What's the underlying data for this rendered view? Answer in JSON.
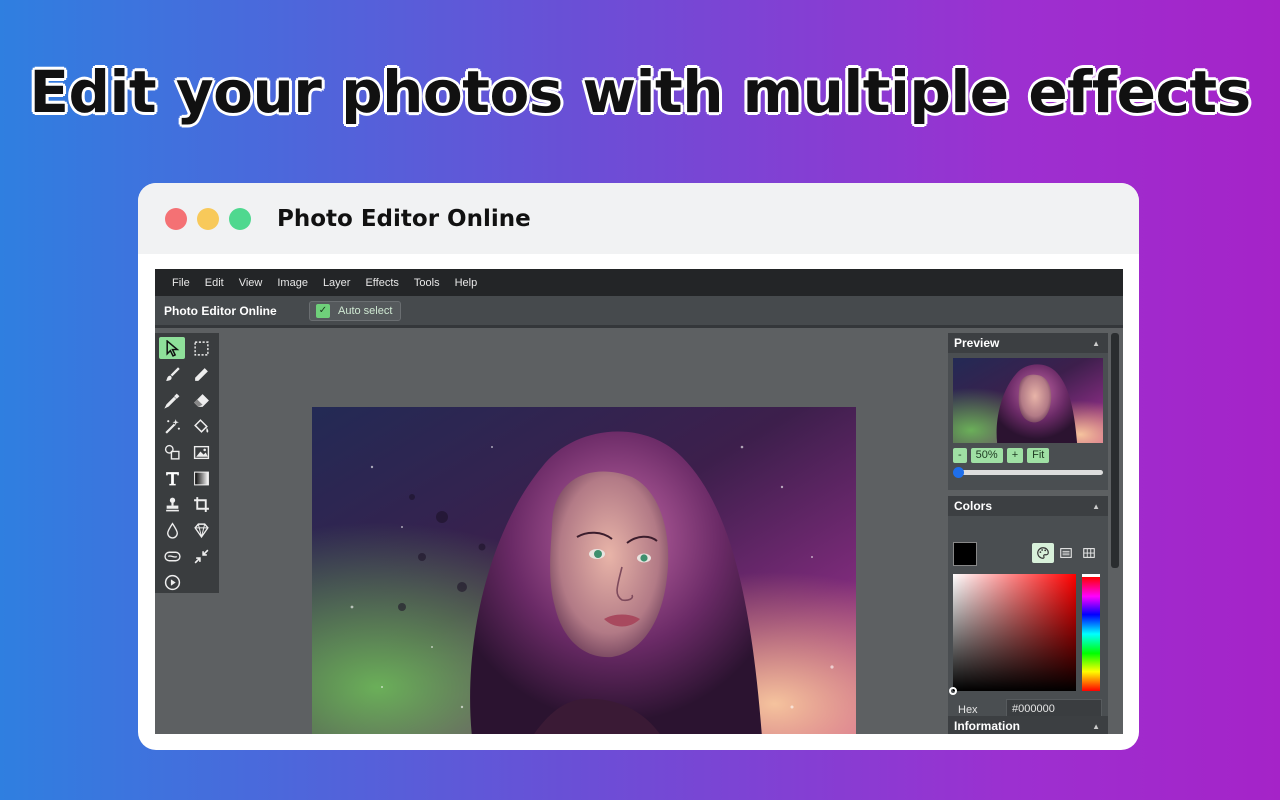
{
  "headline": "Edit your photos with multiple effects",
  "window": {
    "title": "Photo Editor Online"
  },
  "menu": [
    "File",
    "Edit",
    "View",
    "Image",
    "Layer",
    "Effects",
    "Tools",
    "Help"
  ],
  "toolbar": {
    "app_name": "Photo Editor Online",
    "auto_select_label": "Auto select",
    "auto_select_checked": true
  },
  "tools": [
    "select-tool",
    "marquee-select-tool",
    "brush-tool",
    "pencil-tool",
    "eyedropper-tool",
    "eraser-tool",
    "magic-wand-tool",
    "fill-tool",
    "shapes-tool",
    "image-tool",
    "text-tool",
    "gradient-tool",
    "clone-stamp-tool",
    "crop-tool",
    "blur-tool",
    "sharpen-tool",
    "bulge-tool",
    "shrink-tool",
    "animation-tool"
  ],
  "panels": {
    "preview": {
      "title": "Preview",
      "zoom_minus": "-",
      "zoom_value": "50%",
      "zoom_plus": "+",
      "zoom_fit": "Fit",
      "zoom_slider": 0.0
    },
    "colors": {
      "title": "Colors",
      "current_color": "#000000",
      "hex_label": "Hex",
      "hex_value": "#000000"
    },
    "information": {
      "title": "Information"
    }
  },
  "colors": {
    "accent": "#8fe09a",
    "menubar_bg": "#232527",
    "canvas_bg": "#5d6062"
  }
}
